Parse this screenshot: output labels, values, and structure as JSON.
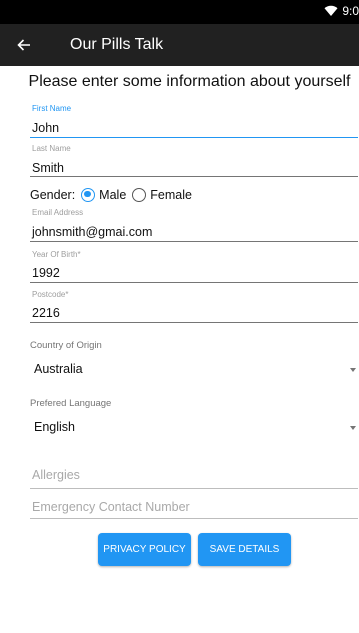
{
  "status_bar": {
    "time": "9:0"
  },
  "app_bar": {
    "title": "Our Pills Talk"
  },
  "heading": "Please enter some information about yourself",
  "fields": {
    "first_name": {
      "label": "First Name",
      "value": "John"
    },
    "last_name": {
      "label": "Last Name",
      "value": "Smith"
    },
    "email": {
      "label": "Email Address",
      "value": "johnsmith@gmai.com"
    },
    "year_of_birth": {
      "label": "Year Of Birth*",
      "value": "1992"
    },
    "postcode": {
      "label": "Postcode*",
      "value": "2216"
    },
    "allergies": {
      "placeholder": "Allergies"
    },
    "emergency_contact": {
      "placeholder": "Emergency Contact Number"
    }
  },
  "gender": {
    "label": "Gender:",
    "options": [
      "Male",
      "Female"
    ],
    "selected": "Male"
  },
  "country": {
    "label": "Country of Origin",
    "value": "Australia"
  },
  "language": {
    "label": "Prefered Language",
    "value": "English"
  },
  "buttons": {
    "privacy": "PRIVACY POLICY",
    "save": "SAVE DETAILS"
  },
  "colors": {
    "accent": "#2196f3",
    "app_bar": "#212121",
    "status_bar": "#000000"
  }
}
